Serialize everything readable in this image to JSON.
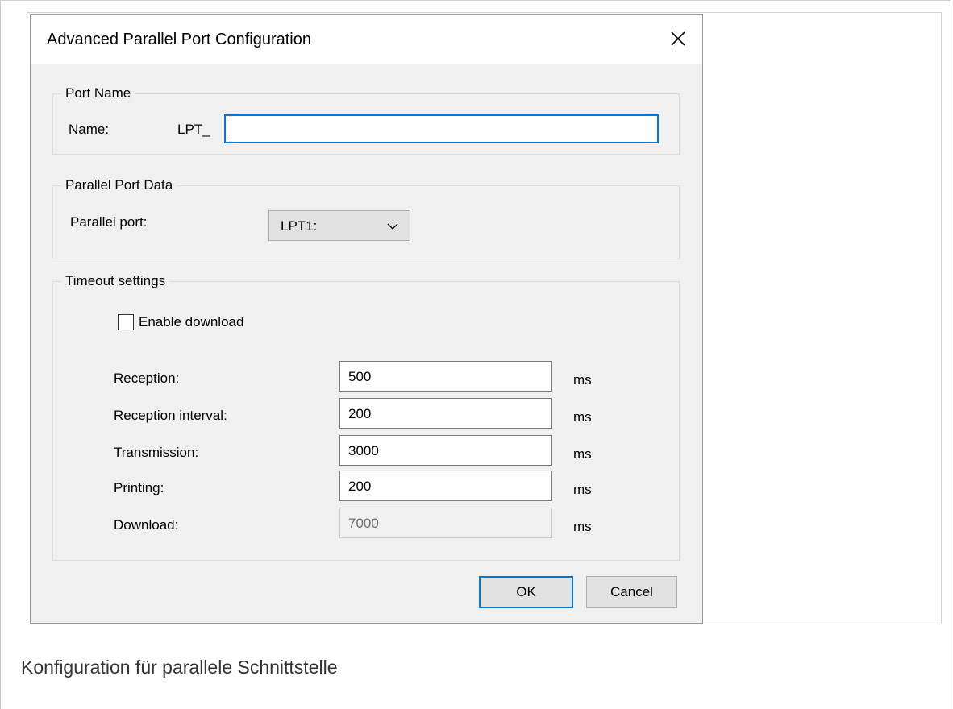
{
  "dialog": {
    "title": "Advanced Parallel Port Configuration"
  },
  "port_name": {
    "group_label": "Port Name",
    "name_label": "Name:",
    "prefix": "LPT_",
    "value": ""
  },
  "parallel_port_data": {
    "group_label": "Parallel Port Data",
    "port_label": "Parallel port:",
    "selected": "LPT1:"
  },
  "timeout": {
    "group_label": "Timeout settings",
    "enable_download_label": "Enable download",
    "enable_download_checked": false,
    "rows": [
      {
        "label": "Reception:",
        "value": "500",
        "unit": "ms",
        "enabled": true
      },
      {
        "label": "Reception interval:",
        "value": "200",
        "unit": "ms",
        "enabled": true
      },
      {
        "label": "Transmission:",
        "value": "3000",
        "unit": "ms",
        "enabled": true
      },
      {
        "label": "Printing:",
        "value": "200",
        "unit": "ms",
        "enabled": true
      },
      {
        "label": "Download:",
        "value": "7000",
        "unit": "ms",
        "enabled": false
      }
    ]
  },
  "buttons": {
    "ok": "OK",
    "cancel": "Cancel"
  },
  "caption": "Konfiguration für parallele Schnittstelle",
  "colors": {
    "accent": "#0078d7",
    "dialog_bg": "#f0f0f0"
  }
}
